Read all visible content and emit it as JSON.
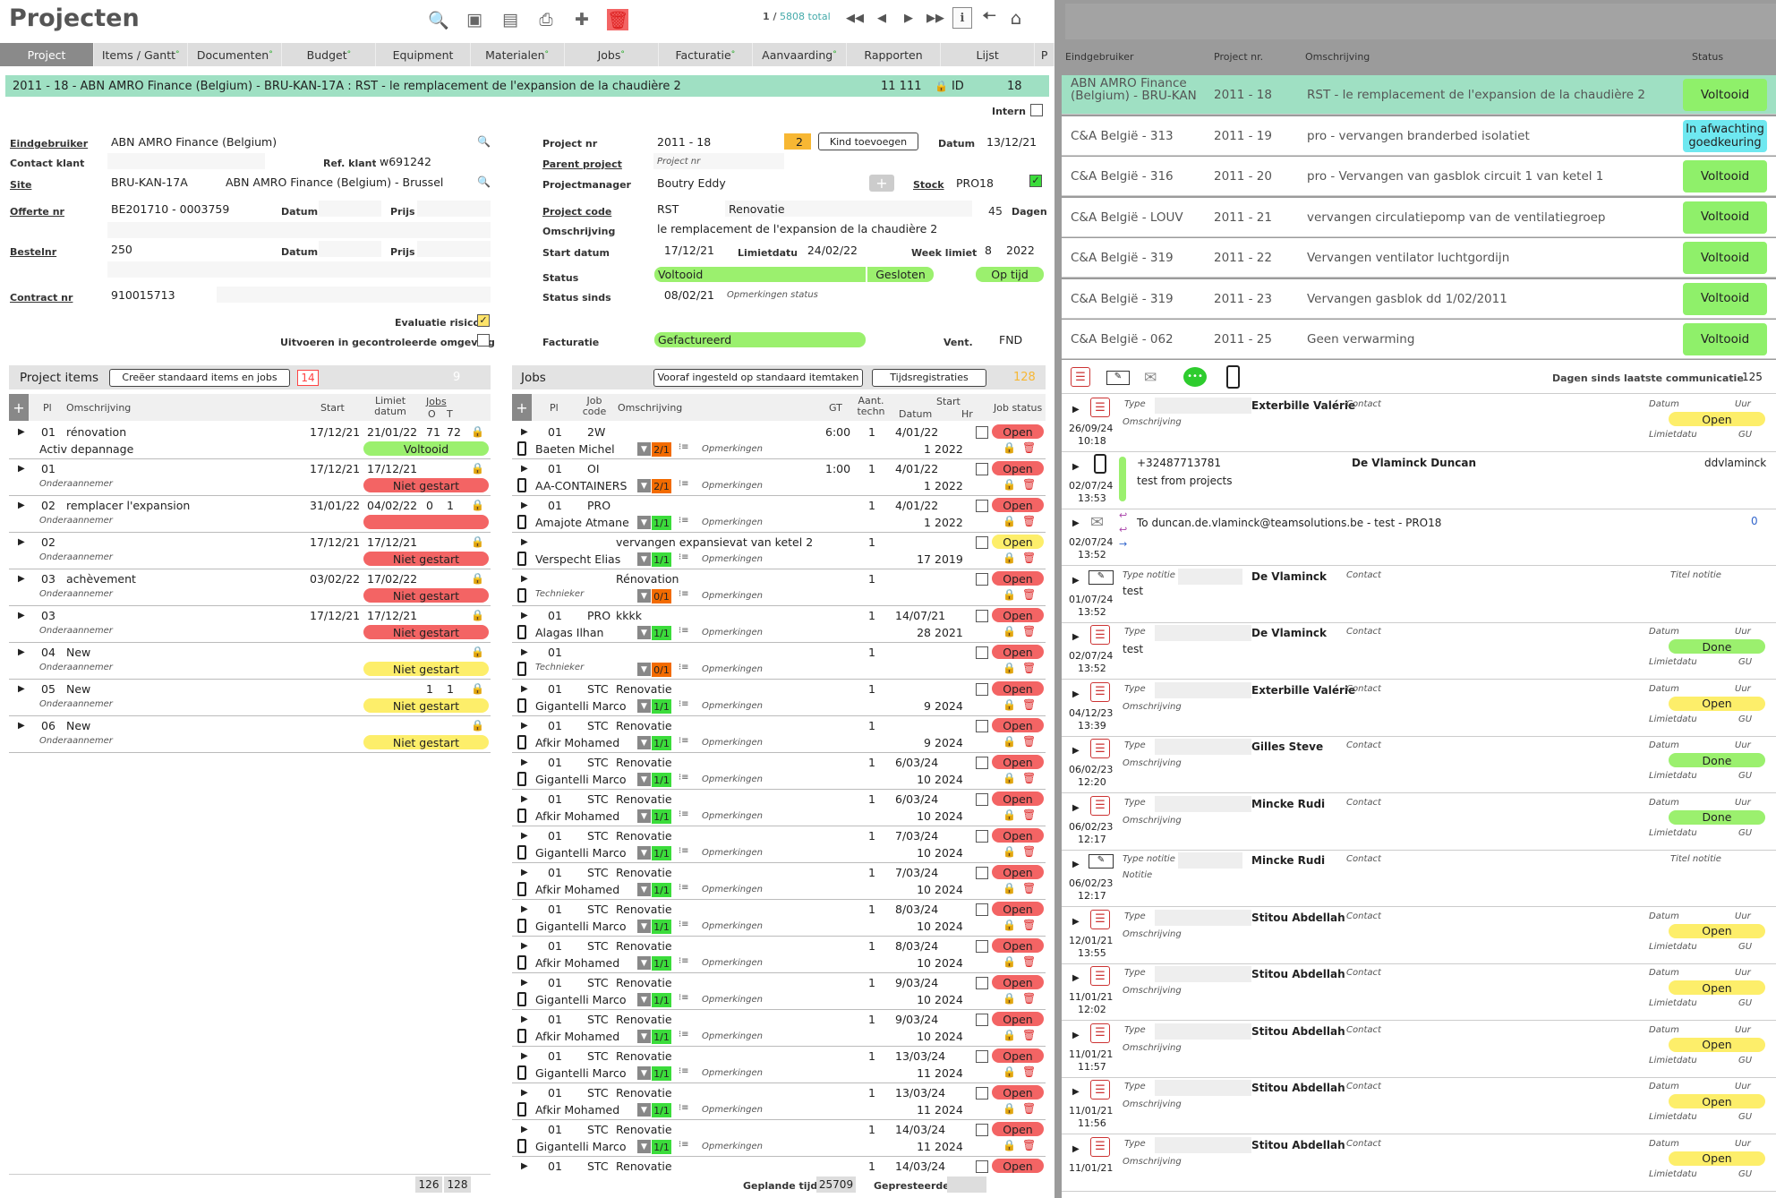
{
  "header": {
    "title": "Projecten",
    "record_position": "1 /",
    "record_total": "5808 total"
  },
  "toolbar_icons": [
    "search-icon",
    "database-icon",
    "list-icon",
    "print-icon",
    "add-icon",
    "trash-icon"
  ],
  "tabs": [
    {
      "label": "Project",
      "mark": ""
    },
    {
      "label": "Items / Gantt",
      "mark": "°"
    },
    {
      "label": "Documenten",
      "mark": "°"
    },
    {
      "label": "Budget",
      "mark": "°"
    },
    {
      "label": "Equipment",
      "mark": ""
    },
    {
      "label": "Materialen",
      "mark": "°"
    },
    {
      "label": "Jobs",
      "mark": "°"
    },
    {
      "label": "Facturatie",
      "mark": "°"
    },
    {
      "label": "Aanvaarding",
      "mark": "°"
    },
    {
      "label": "Rapporten",
      "mark": ""
    },
    {
      "label": "Lijst",
      "mark": ""
    },
    {
      "label": "P",
      "mark": ""
    }
  ],
  "banner": {
    "text": "2011 - 18 - ABN AMRO Finance (Belgium) - BRU-KAN-17A : RST - le remplacement de l'expansion de la chaudière 2",
    "num": "11 111",
    "id_label": "ID",
    "id_value": "18"
  },
  "form": {
    "intern": "Intern",
    "eindgebruiker_label": "Eindgebruiker",
    "eindgebruiker": "ABN AMRO Finance (Belgium)",
    "contact_klant_label": "Contact klant",
    "ref_klant_label": "Ref. klant",
    "ref_klant": "w691242",
    "site_label": "Site",
    "site_code": "BRU-KAN-17A",
    "site_name": "ABN AMRO Finance (Belgium) - Brussel",
    "offerte_label": "Offerte nr",
    "offerte": "BE201710 - 0003759",
    "datum_label": "Datum",
    "prijs_label": "Prijs",
    "bestelnr_label": "Bestelnr",
    "bestelnr": "250",
    "contract_label": "Contract nr",
    "contract": "910015713",
    "evaluatie": "Evaluatie risico",
    "gecontroleerd": "Uitvoeren in gecontroleerde omgeving",
    "project_nr_label": "Project nr",
    "project_nr": "2011 - 18",
    "project_nr_badge": "2",
    "kind_btn": "Kind toevoegen",
    "datum": "13/12/21",
    "parent_label": "Parent project",
    "parent_placeholder": "Project nr",
    "pm_label": "Projectmanager",
    "pm": "Boutry Eddy",
    "stock_label": "Stock",
    "stock": "PRO18",
    "code_label": "Project code",
    "code": "RST",
    "code_name": "Renovatie",
    "dagen": "45",
    "dagen_label": "Dagen",
    "omschr_label": "Omschrijving",
    "omschr": "le remplacement de l'expansion de la chaudière 2",
    "start_label": "Start datum",
    "start": "17/12/21",
    "limiet_label": "Limietdatu",
    "limiet": "24/02/22",
    "week_label": "Week limiet",
    "week": "8",
    "week_year": "2022",
    "status_label": "Status",
    "status": "Voltooid",
    "status2": "Gesloten",
    "status3": "Op tijd",
    "status_sinds_label": "Status sinds",
    "status_sinds": "08/02/21",
    "opm_status": "Opmerkingen status",
    "facturatie_label": "Facturatie",
    "facturatie": "Gefactureerd",
    "vent_label": "Vent.",
    "vent": "FND"
  },
  "items": {
    "title": "Project items",
    "btn": "Creëer standaard items en jobs",
    "count_badge": "14",
    "count": "9",
    "cols": {
      "pl": "Pl",
      "omschr": "Omschrijving",
      "start": "Start",
      "limiet": "Limiet datum",
      "jobs": "Jobs",
      "o": "O",
      "t": "T"
    },
    "rows": [
      {
        "pl": "01",
        "omschr": "rénovation",
        "sub": "Activ depannage",
        "start": "17/12/21",
        "limiet": "21/01/22",
        "o": "71",
        "t": "72",
        "status": "Voltooid",
        "color": "gre"
      },
      {
        "pl": "01",
        "omschr": "",
        "sub": "Onderaannemer",
        "start": "17/12/21",
        "limiet": "17/12/21",
        "o": "",
        "t": "",
        "status": "Niet gestart",
        "color": "red"
      },
      {
        "pl": "02",
        "omschr": "remplacer l'expansion",
        "sub": "Onderaannemer",
        "start": "31/01/22",
        "limiet": "04/02/22",
        "o": "0",
        "t": "1",
        "status": "",
        "color": "red"
      },
      {
        "pl": "02",
        "omschr": "",
        "sub": "Onderaannemer",
        "start": "17/12/21",
        "limiet": "17/12/21",
        "o": "",
        "t": "",
        "status": "Niet gestart",
        "color": "red"
      },
      {
        "pl": "03",
        "omschr": "achèvement",
        "sub": "Onderaannemer",
        "start": "03/02/22",
        "limiet": "17/02/22",
        "o": "",
        "t": "",
        "status": "Niet gestart",
        "color": "red"
      },
      {
        "pl": "03",
        "omschr": "",
        "sub": "Onderaannemer",
        "start": "17/12/21",
        "limiet": "17/12/21",
        "o": "",
        "t": "",
        "status": "Niet gestart",
        "color": "red"
      },
      {
        "pl": "04",
        "omschr": "New",
        "sub": "Onderaannemer",
        "start": "",
        "limiet": "",
        "o": "",
        "t": "",
        "status": "Niet gestart",
        "color": "yel"
      },
      {
        "pl": "05",
        "omschr": "New",
        "sub": "Onderaannemer",
        "start": "",
        "limiet": "",
        "o": "1",
        "t": "1",
        "status": "Niet gestart",
        "color": "yel"
      },
      {
        "pl": "06",
        "omschr": "New",
        "sub": "Onderaannemer",
        "start": "",
        "limiet": "",
        "o": "",
        "t": "",
        "status": "Niet gestart",
        "color": "yel"
      }
    ],
    "totals": [
      "126",
      "128"
    ]
  },
  "jobs": {
    "title": "Jobs",
    "btn1": "Vooraf ingesteld op standaard itemtaken",
    "btn2": "Tijdsregistraties",
    "count": "128",
    "cols": {
      "pl": "Pl",
      "code": "Job code",
      "omschr": "Omschrijving",
      "gt": "GT",
      "aant": "Aant. techn",
      "start": "Start",
      "datum": "Datum",
      "hr": "Hr",
      "status": "Job status"
    },
    "opm": "Opmerkingen",
    "rows": [
      {
        "pl": "01",
        "code": "2W",
        "omschr": "",
        "gt": "6:00",
        "aant": "1",
        "datum": "4/01/22",
        "tech": "Baeten Michel",
        "q": "2/1",
        "qc": "qo",
        "week": "1",
        "yr": "2022",
        "status": "Open",
        "sc": "red"
      },
      {
        "pl": "01",
        "code": "OI",
        "omschr": "",
        "gt": "1:00",
        "aant": "1",
        "datum": "4/01/22",
        "tech": "AA-CONTAINERS",
        "q": "2/1",
        "qc": "qo",
        "week": "1",
        "yr": "2022",
        "status": "Open",
        "sc": "red"
      },
      {
        "pl": "01",
        "code": "PRO",
        "omschr": "",
        "gt": "",
        "aant": "1",
        "datum": "4/01/22",
        "tech": "Amajote Atmane",
        "q": "1/1",
        "qc": "qg",
        "week": "1",
        "yr": "2022",
        "status": "Open",
        "sc": "red"
      },
      {
        "pl": "",
        "code": "",
        "omschr": "vervangen expansievat van ketel 2",
        "gt": "",
        "aant": "1",
        "datum": "",
        "tech": "Verspecht Elias",
        "q": "1/1",
        "qc": "qg",
        "week": "17",
        "yr": "2019",
        "status": "Open",
        "sc": "yel"
      },
      {
        "pl": "",
        "code": "",
        "omschr": "Rénovation",
        "gt": "",
        "aant": "1",
        "datum": "",
        "tech": "Technieker",
        "q": "0/1",
        "qc": "qo",
        "week": "",
        "yr": "",
        "status": "Open",
        "sc": "red"
      },
      {
        "pl": "01",
        "code": "PRO",
        "omschr": "kkkk",
        "gt": "",
        "aant": "1",
        "datum": "14/07/21",
        "tech": "Alagas Ilhan",
        "q": "1/1",
        "qc": "qg",
        "week": "28",
        "yr": "2021",
        "status": "Open",
        "sc": "red"
      },
      {
        "pl": "01",
        "code": "",
        "omschr": "",
        "gt": "",
        "aant": "1",
        "datum": "",
        "tech": "Technieker",
        "q": "0/1",
        "qc": "qo",
        "week": "",
        "yr": "",
        "status": "Open",
        "sc": "red"
      },
      {
        "pl": "01",
        "code": "STC",
        "omschr": "Renovatie",
        "gt": "",
        "aant": "1",
        "datum": "",
        "tech": "Gigantelli Marco",
        "q": "1/1",
        "qc": "qg",
        "week": "9",
        "yr": "2024",
        "status": "Open",
        "sc": "red"
      },
      {
        "pl": "01",
        "code": "STC",
        "omschr": "Renovatie",
        "gt": "",
        "aant": "1",
        "datum": "",
        "tech": "Afkir Mohamed",
        "q": "1/1",
        "qc": "qg",
        "week": "9",
        "yr": "2024",
        "status": "Open",
        "sc": "red"
      },
      {
        "pl": "01",
        "code": "STC",
        "omschr": "Renovatie",
        "gt": "",
        "aant": "1",
        "datum": "6/03/24",
        "tech": "Gigantelli Marco",
        "q": "1/1",
        "qc": "qg",
        "week": "10",
        "yr": "2024",
        "status": "Open",
        "sc": "red"
      },
      {
        "pl": "01",
        "code": "STC",
        "omschr": "Renovatie",
        "gt": "",
        "aant": "1",
        "datum": "6/03/24",
        "tech": "Afkir Mohamed",
        "q": "1/1",
        "qc": "qg",
        "week": "10",
        "yr": "2024",
        "status": "Open",
        "sc": "red"
      },
      {
        "pl": "01",
        "code": "STC",
        "omschr": "Renovatie",
        "gt": "",
        "aant": "1",
        "datum": "7/03/24",
        "tech": "Gigantelli Marco",
        "q": "1/1",
        "qc": "qg",
        "week": "10",
        "yr": "2024",
        "status": "Open",
        "sc": "red"
      },
      {
        "pl": "01",
        "code": "STC",
        "omschr": "Renovatie",
        "gt": "",
        "aant": "1",
        "datum": "7/03/24",
        "tech": "Afkir Mohamed",
        "q": "1/1",
        "qc": "qg",
        "week": "10",
        "yr": "2024",
        "status": "Open",
        "sc": "red"
      },
      {
        "pl": "01",
        "code": "STC",
        "omschr": "Renovatie",
        "gt": "",
        "aant": "1",
        "datum": "8/03/24",
        "tech": "Gigantelli Marco",
        "q": "1/1",
        "qc": "qg",
        "week": "10",
        "yr": "2024",
        "status": "Open",
        "sc": "red"
      },
      {
        "pl": "01",
        "code": "STC",
        "omschr": "Renovatie",
        "gt": "",
        "aant": "1",
        "datum": "8/03/24",
        "tech": "Afkir Mohamed",
        "q": "1/1",
        "qc": "qg",
        "week": "10",
        "yr": "2024",
        "status": "Open",
        "sc": "red"
      },
      {
        "pl": "01",
        "code": "STC",
        "omschr": "Renovatie",
        "gt": "",
        "aant": "1",
        "datum": "9/03/24",
        "tech": "Gigantelli Marco",
        "q": "1/1",
        "qc": "qg",
        "week": "10",
        "yr": "2024",
        "status": "Open",
        "sc": "red"
      },
      {
        "pl": "01",
        "code": "STC",
        "omschr": "Renovatie",
        "gt": "",
        "aant": "1",
        "datum": "9/03/24",
        "tech": "Afkir Mohamed",
        "q": "1/1",
        "qc": "qg",
        "week": "10",
        "yr": "2024",
        "status": "Open",
        "sc": "red"
      },
      {
        "pl": "01",
        "code": "STC",
        "omschr": "Renovatie",
        "gt": "",
        "aant": "1",
        "datum": "13/03/24",
        "tech": "Gigantelli Marco",
        "q": "1/1",
        "qc": "qg",
        "week": "11",
        "yr": "2024",
        "status": "Open",
        "sc": "red"
      },
      {
        "pl": "01",
        "code": "STC",
        "omschr": "Renovatie",
        "gt": "",
        "aant": "1",
        "datum": "13/03/24",
        "tech": "Afkir Mohamed",
        "q": "1/1",
        "qc": "qg",
        "week": "11",
        "yr": "2024",
        "status": "Open",
        "sc": "red"
      },
      {
        "pl": "01",
        "code": "STC",
        "omschr": "Renovatie",
        "gt": "",
        "aant": "1",
        "datum": "14/03/24",
        "tech": "Gigantelli Marco",
        "q": "1/1",
        "qc": "qg",
        "week": "11",
        "yr": "2024",
        "status": "Open",
        "sc": "red"
      },
      {
        "pl": "01",
        "code": "STC",
        "omschr": "Renovatie",
        "gt": "",
        "aant": "1",
        "datum": "14/03/24",
        "tech": "",
        "q": "",
        "qc": "",
        "week": "",
        "yr": "",
        "status": "Open",
        "sc": "red"
      }
    ],
    "footer_gepland": "Geplande tijd",
    "footer_gepland_val": "25709",
    "footer_gepresteerd": "Gepresteerde"
  },
  "right": {
    "cols": {
      "eind": "Eindgebruiker",
      "pnr": "Project nr.",
      "omschr": "Omschrijving",
      "status": "Status"
    },
    "rows": [
      {
        "eind": "ABN AMRO Finance (Belgium) - BRU-KAN",
        "pnr": "2011 - 18",
        "omschr": "RST - le remplacement de l'expansion de la chaudière 2",
        "status": "Voltooid",
        "color": "#8ff06a",
        "sel": true
      },
      {
        "eind": "C&A België - 313",
        "pnr": "2011 - 19",
        "omschr": "pro - vervangen branderbed isolatiet",
        "status": "In afwachting goedkeuring",
        "color": "#6ee8f0",
        "sel": false
      },
      {
        "eind": "C&A België - 316",
        "pnr": "2011 - 20",
        "omschr": "pro - Vervangen van gasblok circuit 1 van ketel 1",
        "status": "Voltooid",
        "color": "#8ff06a",
        "sel": false
      },
      {
        "eind": "C&A België - LOUV",
        "pnr": "2011 - 21",
        "omschr": "vervangen circulatiepomp van de ventilatiegroep",
        "status": "Voltooid",
        "color": "#8ff06a",
        "sel": false
      },
      {
        "eind": "C&A België - 319",
        "pnr": "2011 - 22",
        "omschr": "Vervangen ventilator luchtgordijn",
        "status": "Voltooid",
        "color": "#8ff06a",
        "sel": false
      },
      {
        "eind": "C&A België - 319",
        "pnr": "2011 - 23",
        "omschr": "Vervangen gasblok dd 1/02/2011",
        "status": "Voltooid",
        "color": "#8ff06a",
        "sel": false
      },
      {
        "eind": "C&A België - 062",
        "pnr": "2011 - 25",
        "omschr": "Geen verwarming",
        "status": "Voltooid",
        "color": "#8ff06a",
        "sel": false
      }
    ],
    "comm_label": "Dagen sinds laatste communicatie",
    "comm_days": "125",
    "comm": [
      {
        "kind": "task",
        "date": "26/09/24",
        "time": "10:18",
        "name": "Exterbille Valérie",
        "type": "Type",
        "sub": "Omschrijving",
        "status": "Open",
        "color": "yel"
      },
      {
        "kind": "phone",
        "date": "02/07/24",
        "time": "13:53",
        "name": "De Vlaminck Duncan",
        "phone": "+32487713781",
        "text": "test from projects",
        "user": "ddvlaminck"
      },
      {
        "kind": "mail",
        "date": "02/07/24",
        "time": "13:52",
        "text": "To duncan.de.vlaminck@teamsolutions.be - test - PRO18",
        "num": "0"
      },
      {
        "kind": "note",
        "date": "01/07/24",
        "time": "13:52",
        "name": "De Vlaminck",
        "type": "Type notitie",
        "text": "test",
        "titel": "Titel notitie"
      },
      {
        "kind": "task",
        "date": "02/07/24",
        "time": "13:52",
        "name": "De Vlaminck",
        "type": "Type",
        "text": "test",
        "status": "Done",
        "color": "gre"
      },
      {
        "kind": "task",
        "date": "04/12/23",
        "time": "13:39",
        "name": "Exterbille Valérie",
        "type": "Type",
        "sub": "Omschrijving",
        "status": "Open",
        "color": "yel"
      },
      {
        "kind": "task",
        "date": "06/02/23",
        "time": "12:20",
        "name": "Gilles Steve",
        "type": "Type",
        "sub": "Omschrijving",
        "status": "Done",
        "color": "gre"
      },
      {
        "kind": "task",
        "date": "06/02/23",
        "time": "12:17",
        "name": "Mincke Rudi",
        "type": "Type",
        "sub": "Omschrijving",
        "status": "Done",
        "color": "gre"
      },
      {
        "kind": "note",
        "date": "06/02/23",
        "time": "12:17",
        "name": "Mincke Rudi",
        "type": "Type notitie",
        "sub": "Notitie",
        "titel": "Titel notitie"
      },
      {
        "kind": "task",
        "date": "12/01/21",
        "time": "13:55",
        "name": "Stitou Abdellah",
        "type": "Type",
        "sub": "Omschrijving",
        "status": "Open",
        "color": "yel"
      },
      {
        "kind": "task",
        "date": "11/01/21",
        "time": "12:02",
        "name": "Stitou Abdellah",
        "type": "Type",
        "sub": "Omschrijving",
        "status": "Open",
        "color": "yel"
      },
      {
        "kind": "task",
        "date": "11/01/21",
        "time": "11:57",
        "name": "Stitou Abdellah",
        "type": "Type",
        "sub": "Omschrijving",
        "status": "Open",
        "color": "yel"
      },
      {
        "kind": "task",
        "date": "11/01/21",
        "time": "11:56",
        "name": "Stitou Abdellah",
        "type": "Type",
        "sub": "Omschrijving",
        "status": "Open",
        "color": "yel"
      },
      {
        "kind": "task",
        "date": "11/01/21",
        "time": "",
        "name": "Stitou Abdellah",
        "type": "Type",
        "sub": "Omschrijving",
        "status": "Open",
        "color": "yel"
      }
    ],
    "labels": {
      "contact": "Contact",
      "datum": "Datum",
      "uur": "Uur",
      "limiet": "Limietdatu",
      "gu": "GU"
    }
  }
}
